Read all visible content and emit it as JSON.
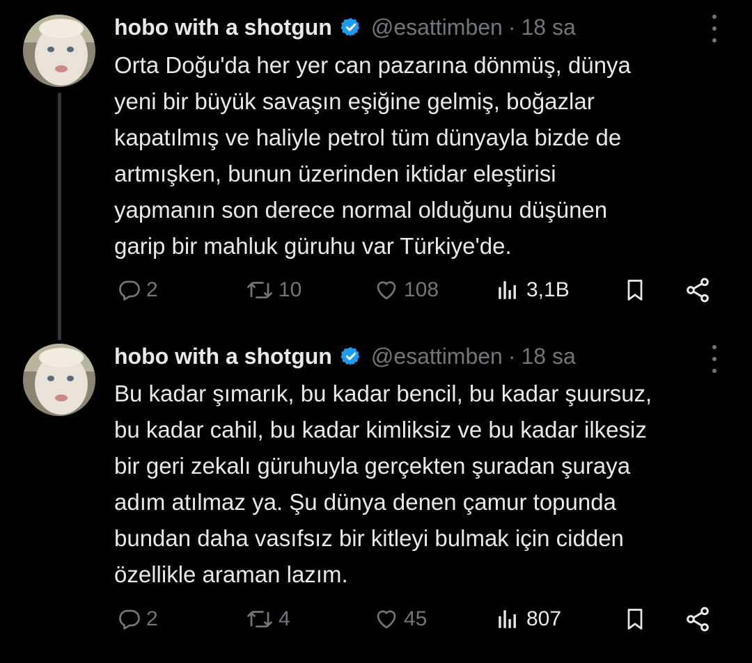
{
  "thread": {
    "tweets": [
      {
        "author": {
          "name": "hobo with a shotgun",
          "handle": "@esattimben",
          "separator": "·",
          "time": "18 sa"
        },
        "lines": [
          "Orta Doğu'da her yer can pazarına dönmüş, dünya",
          "yeni bir büyük savaşın eşiğine gelmiş, boğazlar",
          "kapatılmış ve haliyle petrol tüm dünyayla bizde de",
          "artmışken, bunun üzerinden iktidar eleştirisi",
          "yapmanın son derece normal olduğunu düşünen",
          "garip bir mahluk güruhu var Türkiye'de."
        ],
        "stats": {
          "replies": "2",
          "reposts": "10",
          "likes": "108",
          "views": "3,1B"
        }
      },
      {
        "author": {
          "name": "hobo with a shotgun",
          "handle": "@esattimben",
          "separator": "·",
          "time": "18 sa"
        },
        "lines": [
          "Bu kadar şımarık, bu kadar bencil, bu kadar şuursuz,",
          "bu kadar cahil, bu kadar kimliksiz ve bu kadar ilkesiz",
          "bir geri zekalı güruhuyla gerçekten şuradan şuraya",
          "adım atılmaz ya. Şu dünya denen çamur topunda",
          "bundan daha vasıfsız bir kitleyi bulmak için cidden",
          "özellikle araman lazım."
        ],
        "stats": {
          "replies": "2",
          "reposts": "4",
          "likes": "45",
          "views": "807"
        }
      }
    ]
  },
  "icons": {
    "verified": "verified-badge-icon",
    "reply": "reply-icon",
    "repost": "repost-icon",
    "like": "heart-icon",
    "views": "views-bar-chart-icon",
    "bookmark": "bookmark-icon",
    "share": "share-icon",
    "more": "more-vertical-icon"
  },
  "colors": {
    "background": "#000000",
    "text": "#e7e9ea",
    "muted": "#71767b",
    "verified": "#1d9bf0",
    "thread_line": "#333639"
  }
}
